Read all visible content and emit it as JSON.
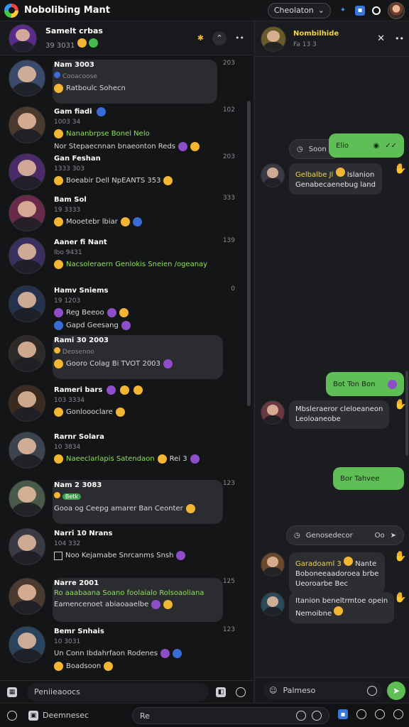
{
  "app": {
    "title": "Nobolibing Mant"
  },
  "topbar": {
    "dropdown_label": "Cheolaton",
    "dropdown_icon": "chevron-down-icon"
  },
  "pinned": {
    "name": "Samelt crbas",
    "subtitle": "39 3031"
  },
  "conversations": [
    {
      "name": "Nam 3003",
      "subtitle": "Cooacoose",
      "message": "Ratboulc Sohecn",
      "time": "203",
      "green": false,
      "highlight": true
    },
    {
      "name": "Gam fiadi",
      "subtitle": "1003 34",
      "message": "Nananbrpse Bonel Nelo",
      "message2": "Nor Stepaecnnan bnaeonton Reds",
      "time": "102",
      "green": true,
      "highlight": false
    },
    {
      "name": "Gan Feshan",
      "subtitle": "1333 303",
      "message": "Boeabir Dell NpEANTS 353",
      "time": "203",
      "green": false,
      "highlight": false
    },
    {
      "name": "Bam Sol",
      "subtitle": "19 3333",
      "message": "Mooetebr lbiar",
      "time": "333",
      "green": false,
      "highlight": false
    },
    {
      "name": "Aaner fi Nant",
      "subtitle": "Ibo 9431",
      "message": "Nacsoleraern Genlokis Sneien /ogeanay",
      "time": "139",
      "green": true,
      "highlight": false
    },
    {
      "name": "Hamv Sniems",
      "subtitle": "19 1203",
      "message": "Reg Beeoo",
      "message2": "Gapd Geesang",
      "time": "0",
      "green": false,
      "highlight": false
    },
    {
      "name": "Rami 30 2003",
      "subtitle": "Deosenoo",
      "message": "Gooro Colag Bi TVOT 2003",
      "time": "",
      "green": false,
      "highlight": true
    },
    {
      "name": "Rameri bars",
      "subtitle": "103 3334",
      "message": "Gonloooclare",
      "time": "",
      "green": false,
      "highlight": false
    },
    {
      "name": "Rarnr Solara",
      "subtitle": "10 3834",
      "message": "Naeeclarlapis Satendaon",
      "message2": "Rei 3",
      "time": "",
      "green": true,
      "highlight": false
    },
    {
      "name": "Nam 2 3083",
      "subtitle": "Betk",
      "message": "Gooa og Ceepg amarer Ban Ceonter",
      "time": "123",
      "green": false,
      "highlight": true
    },
    {
      "name": "Narri 10 Nrans",
      "subtitle": "104 332",
      "message": "Noo Kejamabe Snrcanms Snsh",
      "time": "",
      "green": false,
      "highlight": false
    },
    {
      "name": "Narre 2001",
      "subtitle": "Ro aaabaana Soano foolaialo Rolsoaoliana",
      "message": "Eamencenoet abiaoaaelbe",
      "time": "125",
      "green": false,
      "highlight": true
    },
    {
      "name": "Bemr Snhais",
      "subtitle": "10 3031",
      "message": "Un Conn Ibdahrfaon Rodenes",
      "message2": "Boadsoon",
      "time": "123",
      "green": false,
      "highlight": false
    }
  ],
  "left_compose": {
    "placeholder": "Peniieaoocs"
  },
  "chat_header": {
    "name": "Nombilhide",
    "subtitle": "Fa 13 3"
  },
  "chat": {
    "sys1": "Soon",
    "out1": "Elio",
    "in1_name": "Gelbalbe Jl",
    "in1_rest": "Islanion",
    "in1_line2": "Genabecaenebug land",
    "out2": "Bot Ton  Bon",
    "in2_line1": "Mbsleraeror cleloeaneon",
    "in2_line2": "Leoloaneobe",
    "out3": "Bor Tahvee",
    "sys2": "Genosedecor",
    "sys2_right": "Oo",
    "in3_name": "Garadoaml 3",
    "in3_rest": "Nante",
    "in3_line2": "Boboneeaadoroea brbe",
    "in3_line3": "Ueoroarbe Bec",
    "in4_line1": "Itanion beneltrmtoe opein",
    "in4_line2": "Nemoibne"
  },
  "right_compose": {
    "placeholder": "Palmeso"
  },
  "bottombar": {
    "left_label": "Deemnesec",
    "search_placeholder": "Re"
  },
  "colors": {
    "accent_green": "#5fbe55",
    "name_yellow": "#f2d34a",
    "background": "#1a1b1e"
  }
}
